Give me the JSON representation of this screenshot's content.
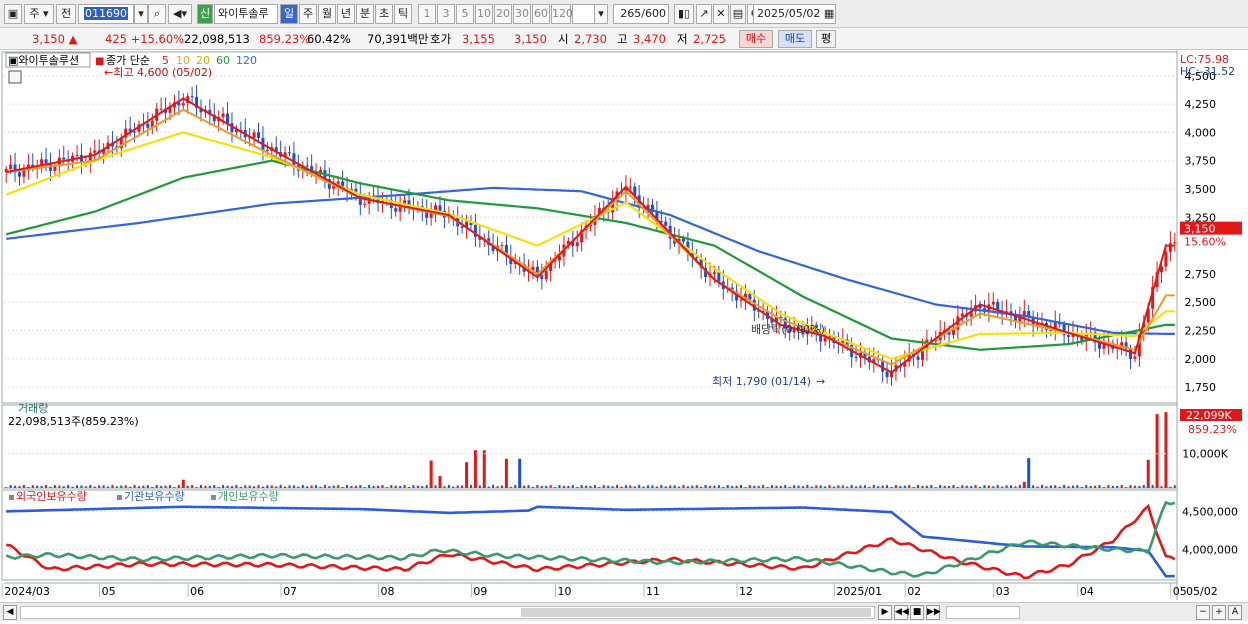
{
  "toolbar": {
    "market_label": "주",
    "prev_label": "전",
    "stock_code": "011690",
    "new_badge": "신",
    "stock_name": "와이투솔루",
    "periods": [
      "일",
      "주",
      "월",
      "년",
      "분",
      "초",
      "틱"
    ],
    "active_period": "일",
    "intervals": [
      "1",
      "3",
      "5",
      "10",
      "20",
      "30",
      "60",
      "120"
    ],
    "count_current": "265",
    "count_max": "/600",
    "date": "2025/05/02"
  },
  "quote": {
    "price": "3,150",
    "change": "425",
    "change_pct": "+15.60%",
    "volume": "22,098,513",
    "volume_ratio": "859.23%",
    "turnover": "60.42%",
    "amount": "70,391백만",
    "bid_label": "호가",
    "bid": "3,155",
    "ask": "3,150",
    "open_label": "시",
    "open": "2,730",
    "high_label": "고",
    "high": "3,470",
    "low_label": "저",
    "low": "2,725",
    "buy_label": "매수",
    "sell_label": "매도",
    "avg_label": "평"
  },
  "colors": {
    "up": "#e01818",
    "down": "#1f4fd0",
    "ma5": "#e01818",
    "ma10": "#f09a28",
    "ma20": "#f5e10a",
    "ma60": "#1f9a3a",
    "ma120": "#3366dd",
    "foreign": "#e01818",
    "institution": "#2a5ed8",
    "individual": "#3a9a6a"
  },
  "chart_data": [
    {
      "type": "line",
      "title": "와이투솔루션",
      "legend": {
        "prefix": "종가 단순",
        "periods": [
          "5",
          "10",
          "20",
          "60",
          "120"
        ]
      },
      "last_price": 3150,
      "last_change_pct": "15.60%",
      "y_ticks": [
        "4,500",
        "4,250",
        "4,000",
        "3,750",
        "3,500",
        "3,250",
        "2,750",
        "2,500",
        "2,250",
        "2,000",
        "1,750"
      ],
      "ylim": [
        1610,
        4710
      ],
      "lc_label": "LC:75.98",
      "hc_label": "HC:-31.52",
      "annotations": {
        "high": "최고 4,600 (05/02)",
        "low": "최저 1,790 (01/14)",
        "dividend": "배당락(0.00%)"
      },
      "series": [
        {
          "name": "5",
          "x": [
            0,
            20,
            40,
            60,
            80,
            100,
            120,
            140,
            160,
            175,
            185,
            200,
            220,
            240,
            255,
            262
          ],
          "values": [
            3650,
            3800,
            4300,
            3850,
            3420,
            3270,
            2720,
            3520,
            2700,
            2300,
            2200,
            1880,
            2480,
            2230,
            2050,
            3000
          ]
        },
        {
          "name": "10",
          "x": [
            0,
            20,
            40,
            60,
            80,
            100,
            120,
            140,
            160,
            175,
            185,
            200,
            220,
            240,
            255,
            262
          ],
          "values": [
            3650,
            3750,
            4200,
            3800,
            3420,
            3260,
            2750,
            3480,
            2700,
            2350,
            2200,
            1950,
            2400,
            2230,
            2080,
            2560
          ]
        },
        {
          "name": "20",
          "x": [
            0,
            20,
            40,
            60,
            80,
            100,
            120,
            140,
            160,
            175,
            185,
            200,
            220,
            240,
            255,
            262
          ],
          "values": [
            3450,
            3750,
            4000,
            3780,
            3450,
            3280,
            3000,
            3380,
            2800,
            2400,
            2230,
            2000,
            2220,
            2230,
            2200,
            2420
          ]
        },
        {
          "name": "60",
          "x": [
            0,
            20,
            40,
            60,
            80,
            100,
            120,
            140,
            160,
            180,
            200,
            220,
            240,
            262
          ],
          "values": [
            3100,
            3300,
            3600,
            3750,
            3550,
            3400,
            3330,
            3200,
            3000,
            2550,
            2180,
            2080,
            2130,
            2300
          ]
        },
        {
          "name": "120",
          "x": [
            0,
            30,
            60,
            90,
            110,
            130,
            150,
            170,
            190,
            210,
            230,
            250,
            262
          ],
          "values": [
            3060,
            3200,
            3370,
            3450,
            3510,
            3480,
            3270,
            2950,
            2700,
            2480,
            2380,
            2230,
            2220
          ]
        }
      ]
    },
    {
      "type": "bar",
      "title": "거래량",
      "summary": "22,098,513주(859.23%)",
      "last_label": "22,099K",
      "last_pct": "859.23%",
      "y_ticks": [
        "10,000K"
      ],
      "ylim": [
        0,
        23000
      ],
      "x": [
        40,
        96,
        98,
        104,
        106,
        108,
        113,
        116,
        230,
        231,
        258,
        260,
        262
      ],
      "values": [
        2400,
        8000,
        3500,
        7500,
        11000,
        11000,
        8500,
        8500,
        1800,
        8700,
        8200,
        21500,
        22099
      ]
    },
    {
      "type": "line",
      "legend": [
        "외국인보유수량",
        "기관보유수량",
        "개인보유수량"
      ],
      "y_ticks": [
        "4,500,000",
        "4,000,000"
      ],
      "ylim": [
        3600000,
        4780000
      ],
      "series": [
        {
          "name": "외국인보유수량",
          "x": [
            0,
            10,
            30,
            60,
            90,
            100,
            120,
            150,
            180,
            200,
            215,
            230,
            240,
            250,
            258,
            262
          ],
          "values": [
            4060,
            3740,
            3810,
            3800,
            3740,
            3940,
            3740,
            3870,
            3750,
            4130,
            3850,
            3640,
            3800,
            4120,
            4550,
            3890
          ]
        },
        {
          "name": "기관보유수량",
          "x": [
            0,
            40,
            80,
            100,
            118,
            120,
            140,
            180,
            200,
            207,
            230,
            250,
            258,
            262
          ],
          "values": [
            4500,
            4560,
            4530,
            4480,
            4510,
            4560,
            4520,
            4550,
            4490,
            4170,
            4040,
            4030,
            3980,
            3650
          ]
        },
        {
          "name": "개인보유수량",
          "x": [
            0,
            10,
            30,
            60,
            90,
            98,
            110,
            150,
            180,
            200,
            207,
            230,
            250,
            258,
            262
          ],
          "values": [
            3900,
            3930,
            3870,
            3920,
            3890,
            3990,
            3920,
            3830,
            3880,
            3700,
            3660,
            4100,
            4000,
            3980,
            4620
          ]
        }
      ]
    }
  ],
  "x_axis": {
    "ticks": [
      "2024/03",
      "05",
      "06",
      "07",
      "08",
      "09",
      "10",
      "11",
      "12",
      "2025/01",
      "02",
      "03",
      "04",
      "05"
    ],
    "end_label": "05/02"
  }
}
